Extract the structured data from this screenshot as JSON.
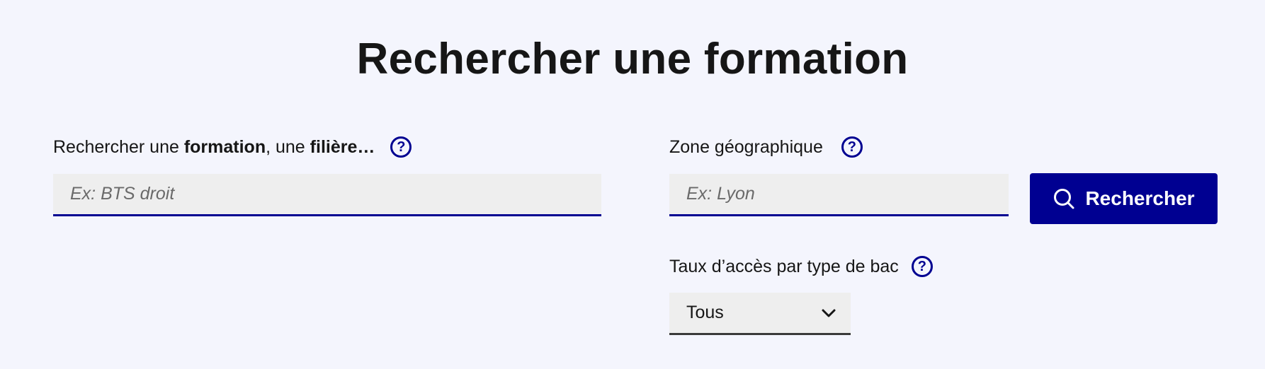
{
  "page": {
    "title": "Rechercher une formation"
  },
  "formation": {
    "label_part1": "Rechercher une ",
    "label_bold1": "formation",
    "label_part2": ", une ",
    "label_bold2": "filière",
    "label_part3": "…",
    "help": "?",
    "placeholder": "Ex: BTS droit",
    "value": ""
  },
  "zone": {
    "label": "Zone géographique",
    "help": "?",
    "placeholder": "Ex: Lyon",
    "value": ""
  },
  "search_button": {
    "label": "Rechercher",
    "icon": "search-icon"
  },
  "taux": {
    "label": "Taux d’accès par type de bac",
    "help": "?",
    "selected": "Tous",
    "icon": "chevron-down-icon"
  },
  "colors": {
    "background": "#f4f5fd",
    "accent": "#000091",
    "field_bg": "#eeeeee",
    "text": "#161616"
  }
}
